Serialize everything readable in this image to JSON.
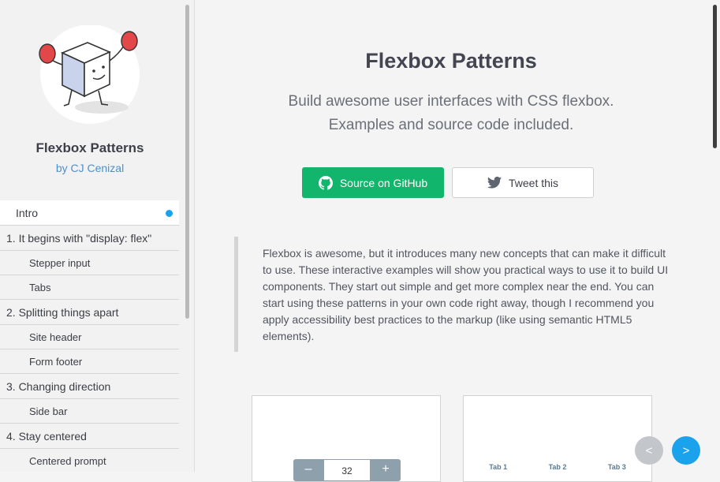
{
  "sidebar": {
    "title": "Flexbox Patterns",
    "author": "by CJ Cenizal",
    "active_item": "Intro",
    "sections": [
      {
        "label": "1. It begins with \"display: flex\"",
        "items": [
          "Stepper input",
          "Tabs"
        ]
      },
      {
        "label": "2. Splitting things apart",
        "items": [
          "Site header",
          "Form footer"
        ]
      },
      {
        "label": "3. Changing direction",
        "items": [
          "Side bar"
        ]
      },
      {
        "label": "4. Stay centered",
        "items": [
          "Centered prompt"
        ]
      }
    ]
  },
  "main": {
    "title": "Flexbox Patterns",
    "subtitle_line1": "Build awesome user interfaces with CSS flexbox.",
    "subtitle_line2": "Examples and source code included.",
    "github_button": "Source on GitHub",
    "tweet_button": "Tweet this",
    "intro": "Flexbox is awesome, but it introduces many new concepts that can make it difficult to use. These interactive examples will show you practical ways to use it to build UI components. They start out simple and get more complex near the end. You can start using these patterns in your own code right away, though I recommend you apply accessibility best practices to the markup (like using semantic HTML5 elements).",
    "stepper": {
      "minus": "–",
      "value": "32",
      "plus": "+"
    },
    "tabs": [
      "Tab 1",
      "Tab 2",
      "Tab 3"
    ],
    "pager": {
      "prev": "<",
      "next": ">"
    }
  },
  "colors": {
    "accent_blue": "#1aa3ec",
    "github_green": "#12b56c",
    "author_link": "#4b8fd0"
  },
  "icons": [
    "mascot-logo",
    "github-icon",
    "twitter-icon",
    "active-dot-icon"
  ]
}
